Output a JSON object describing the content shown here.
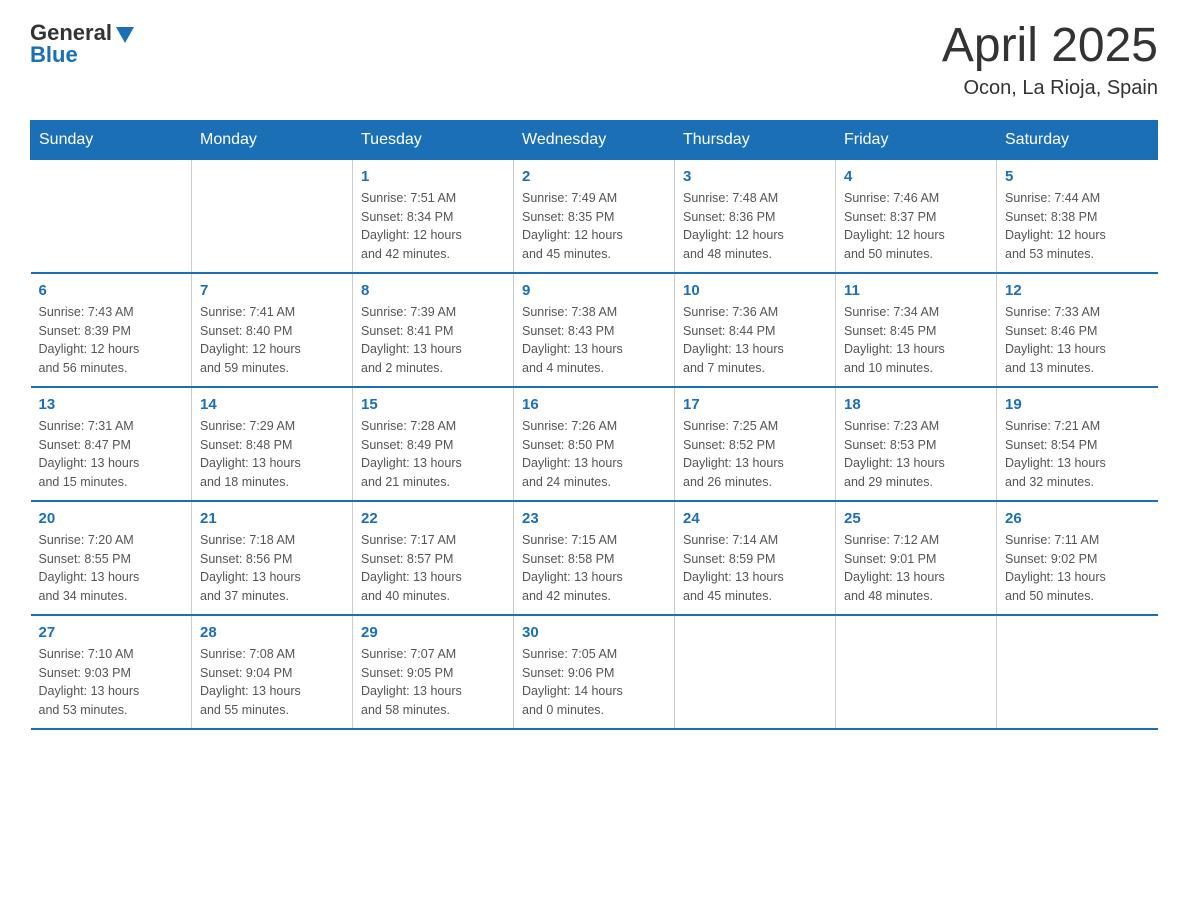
{
  "header": {
    "logo_general": "General",
    "logo_blue": "Blue",
    "title": "April 2025",
    "subtitle": "Ocon, La Rioja, Spain"
  },
  "calendar": {
    "days_of_week": [
      "Sunday",
      "Monday",
      "Tuesday",
      "Wednesday",
      "Thursday",
      "Friday",
      "Saturday"
    ],
    "weeks": [
      [
        {
          "day": "",
          "info": ""
        },
        {
          "day": "",
          "info": ""
        },
        {
          "day": "1",
          "info": "Sunrise: 7:51 AM\nSunset: 8:34 PM\nDaylight: 12 hours\nand 42 minutes."
        },
        {
          "day": "2",
          "info": "Sunrise: 7:49 AM\nSunset: 8:35 PM\nDaylight: 12 hours\nand 45 minutes."
        },
        {
          "day": "3",
          "info": "Sunrise: 7:48 AM\nSunset: 8:36 PM\nDaylight: 12 hours\nand 48 minutes."
        },
        {
          "day": "4",
          "info": "Sunrise: 7:46 AM\nSunset: 8:37 PM\nDaylight: 12 hours\nand 50 minutes."
        },
        {
          "day": "5",
          "info": "Sunrise: 7:44 AM\nSunset: 8:38 PM\nDaylight: 12 hours\nand 53 minutes."
        }
      ],
      [
        {
          "day": "6",
          "info": "Sunrise: 7:43 AM\nSunset: 8:39 PM\nDaylight: 12 hours\nand 56 minutes."
        },
        {
          "day": "7",
          "info": "Sunrise: 7:41 AM\nSunset: 8:40 PM\nDaylight: 12 hours\nand 59 minutes."
        },
        {
          "day": "8",
          "info": "Sunrise: 7:39 AM\nSunset: 8:41 PM\nDaylight: 13 hours\nand 2 minutes."
        },
        {
          "day": "9",
          "info": "Sunrise: 7:38 AM\nSunset: 8:43 PM\nDaylight: 13 hours\nand 4 minutes."
        },
        {
          "day": "10",
          "info": "Sunrise: 7:36 AM\nSunset: 8:44 PM\nDaylight: 13 hours\nand 7 minutes."
        },
        {
          "day": "11",
          "info": "Sunrise: 7:34 AM\nSunset: 8:45 PM\nDaylight: 13 hours\nand 10 minutes."
        },
        {
          "day": "12",
          "info": "Sunrise: 7:33 AM\nSunset: 8:46 PM\nDaylight: 13 hours\nand 13 minutes."
        }
      ],
      [
        {
          "day": "13",
          "info": "Sunrise: 7:31 AM\nSunset: 8:47 PM\nDaylight: 13 hours\nand 15 minutes."
        },
        {
          "day": "14",
          "info": "Sunrise: 7:29 AM\nSunset: 8:48 PM\nDaylight: 13 hours\nand 18 minutes."
        },
        {
          "day": "15",
          "info": "Sunrise: 7:28 AM\nSunset: 8:49 PM\nDaylight: 13 hours\nand 21 minutes."
        },
        {
          "day": "16",
          "info": "Sunrise: 7:26 AM\nSunset: 8:50 PM\nDaylight: 13 hours\nand 24 minutes."
        },
        {
          "day": "17",
          "info": "Sunrise: 7:25 AM\nSunset: 8:52 PM\nDaylight: 13 hours\nand 26 minutes."
        },
        {
          "day": "18",
          "info": "Sunrise: 7:23 AM\nSunset: 8:53 PM\nDaylight: 13 hours\nand 29 minutes."
        },
        {
          "day": "19",
          "info": "Sunrise: 7:21 AM\nSunset: 8:54 PM\nDaylight: 13 hours\nand 32 minutes."
        }
      ],
      [
        {
          "day": "20",
          "info": "Sunrise: 7:20 AM\nSunset: 8:55 PM\nDaylight: 13 hours\nand 34 minutes."
        },
        {
          "day": "21",
          "info": "Sunrise: 7:18 AM\nSunset: 8:56 PM\nDaylight: 13 hours\nand 37 minutes."
        },
        {
          "day": "22",
          "info": "Sunrise: 7:17 AM\nSunset: 8:57 PM\nDaylight: 13 hours\nand 40 minutes."
        },
        {
          "day": "23",
          "info": "Sunrise: 7:15 AM\nSunset: 8:58 PM\nDaylight: 13 hours\nand 42 minutes."
        },
        {
          "day": "24",
          "info": "Sunrise: 7:14 AM\nSunset: 8:59 PM\nDaylight: 13 hours\nand 45 minutes."
        },
        {
          "day": "25",
          "info": "Sunrise: 7:12 AM\nSunset: 9:01 PM\nDaylight: 13 hours\nand 48 minutes."
        },
        {
          "day": "26",
          "info": "Sunrise: 7:11 AM\nSunset: 9:02 PM\nDaylight: 13 hours\nand 50 minutes."
        }
      ],
      [
        {
          "day": "27",
          "info": "Sunrise: 7:10 AM\nSunset: 9:03 PM\nDaylight: 13 hours\nand 53 minutes."
        },
        {
          "day": "28",
          "info": "Sunrise: 7:08 AM\nSunset: 9:04 PM\nDaylight: 13 hours\nand 55 minutes."
        },
        {
          "day": "29",
          "info": "Sunrise: 7:07 AM\nSunset: 9:05 PM\nDaylight: 13 hours\nand 58 minutes."
        },
        {
          "day": "30",
          "info": "Sunrise: 7:05 AM\nSunset: 9:06 PM\nDaylight: 14 hours\nand 0 minutes."
        },
        {
          "day": "",
          "info": ""
        },
        {
          "day": "",
          "info": ""
        },
        {
          "day": "",
          "info": ""
        }
      ]
    ]
  }
}
